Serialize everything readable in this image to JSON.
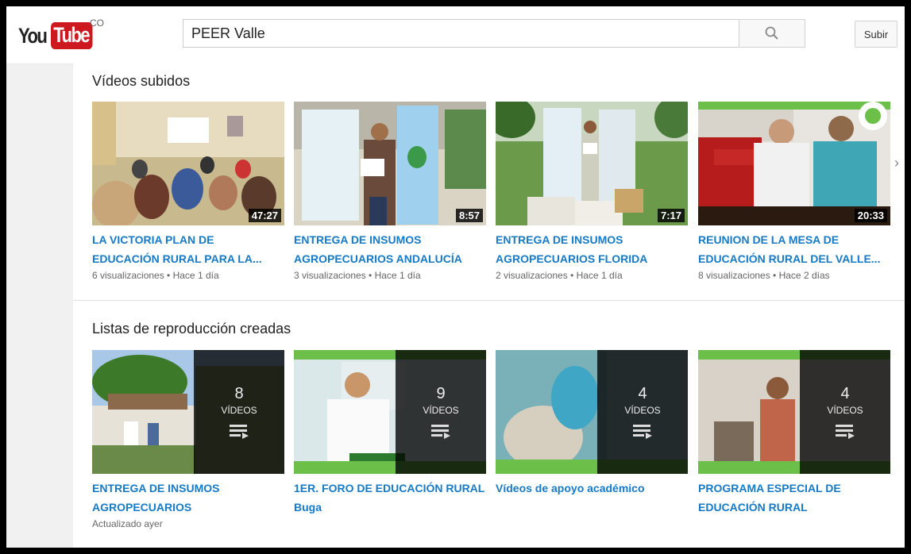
{
  "header": {
    "logo_you": "You",
    "logo_tube": "Tube",
    "region": "CO",
    "search_value": "PEER Valle",
    "upload_label": "Subir"
  },
  "uploads": {
    "title": "Vídeos subidos",
    "videos": [
      {
        "title": "LA VICTORIA PLAN DE EDUCACIÓN RURAL PARA LA...",
        "duration": "47:27",
        "views": "6 visualizaciones",
        "age": "Hace 1 día"
      },
      {
        "title": "ENTREGA DE INSUMOS AGROPECUARIOS ANDALUCÍA",
        "duration": "8:57",
        "views": "3 visualizaciones",
        "age": "Hace 1 día"
      },
      {
        "title": "ENTREGA DE INSUMOS AGROPECUARIOS FLORIDA",
        "duration": "7:17",
        "views": "2 visualizaciones",
        "age": "Hace 1 día"
      },
      {
        "title": "REUNION DE LA MESA DE EDUCACIÓN RURAL DEL VALLE...",
        "duration": "20:33",
        "views": "8 visualizaciones",
        "age": "Hace 2 días"
      }
    ]
  },
  "playlists": {
    "title": "Listas de reproducción creadas",
    "items": [
      {
        "title": "ENTREGA DE INSUMOS AGROPECUARIOS",
        "count": "8",
        "label": "VÍDEOS",
        "updated": "Actualizado ayer"
      },
      {
        "title": "1ER. FORO DE EDUCACIÓN RURAL Buga",
        "count": "9",
        "label": "VÍDEOS",
        "updated": ""
      },
      {
        "title": "Vídeos de apoyo académico",
        "count": "4",
        "label": "VÍDEOS",
        "updated": ""
      },
      {
        "title": "PROGRAMA ESPECIAL DE EDUCACIÓN RURAL",
        "count": "4",
        "label": "VÍDEOS",
        "updated": ""
      }
    ]
  },
  "colors": {
    "brand_red": "#cc181e",
    "link_blue": "#167ac6"
  },
  "icons": {
    "search": "search-icon",
    "next": "chevron-right-icon",
    "playlist": "playlist-icon"
  }
}
